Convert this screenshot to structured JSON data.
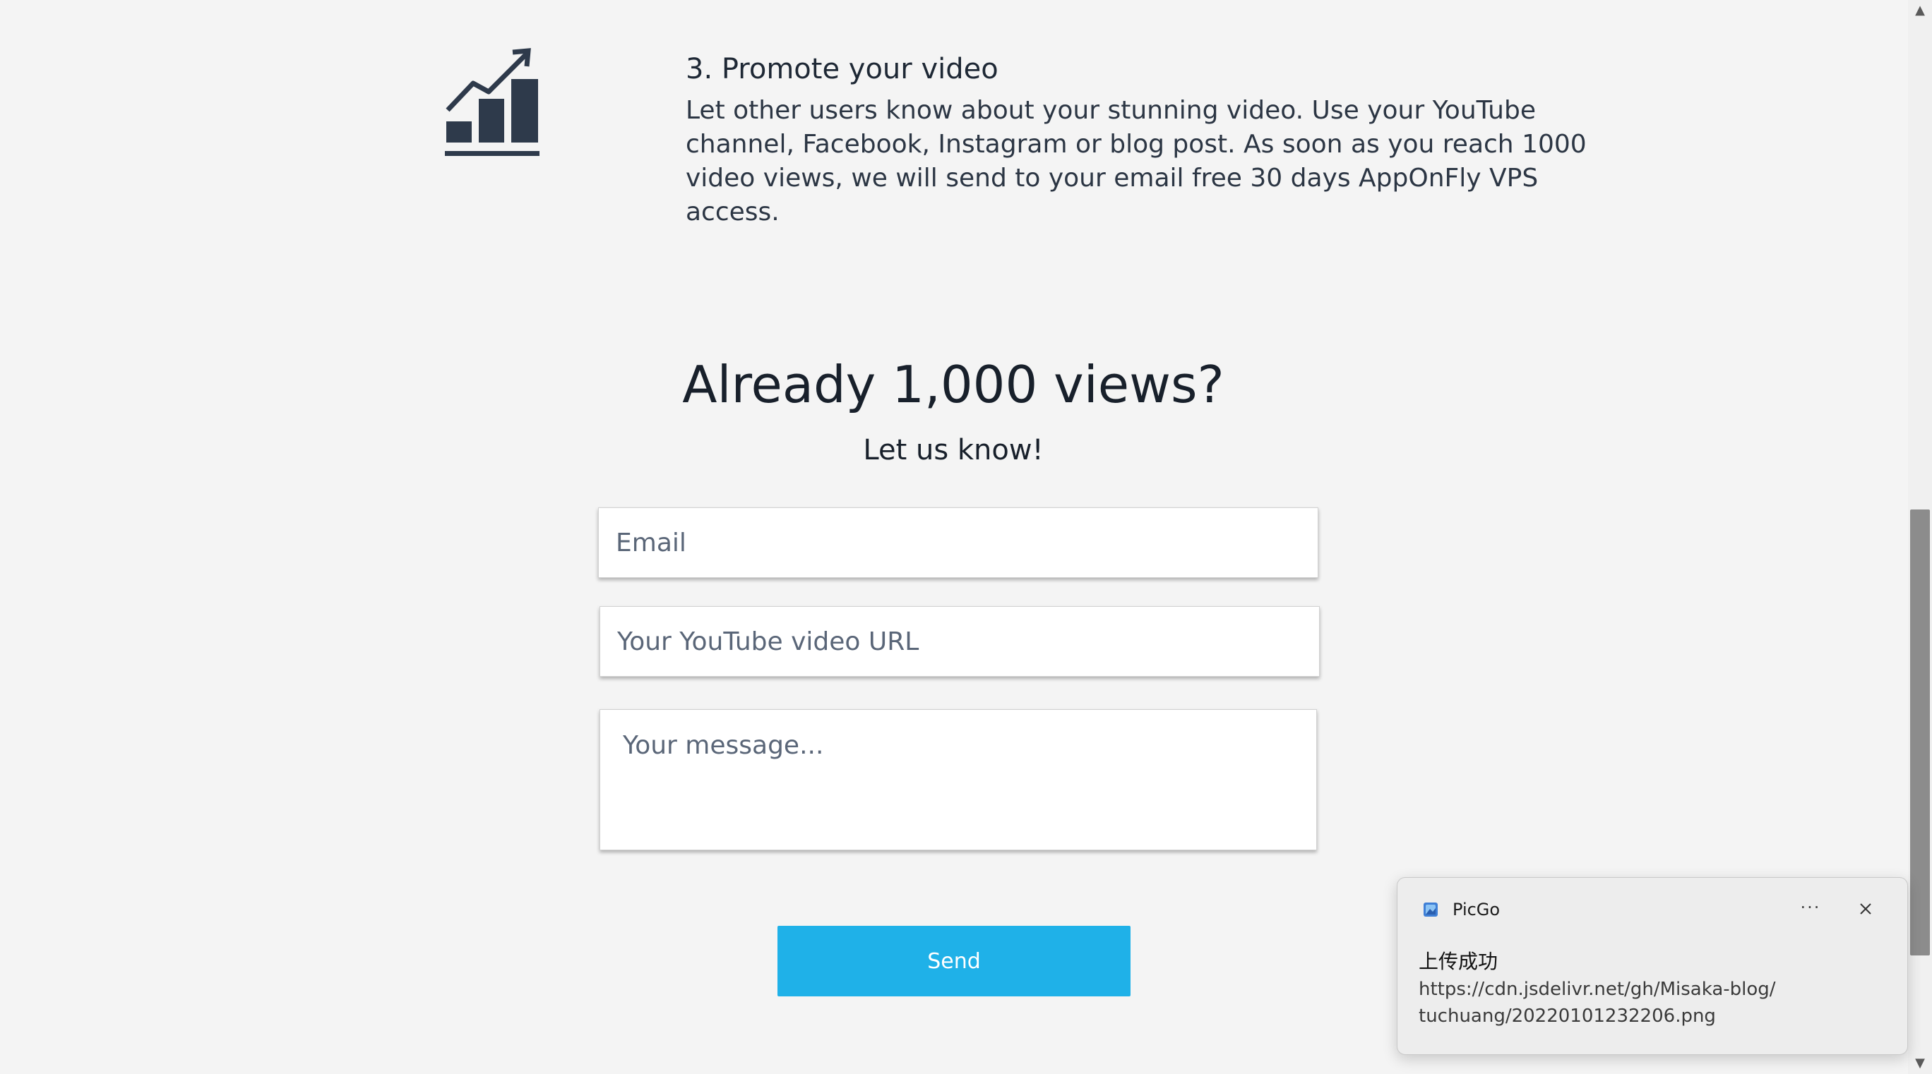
{
  "step": {
    "icon": "growth-chart-icon",
    "title": "3. Promote your video",
    "description": "Let other users know about your stunning video. Use your YouTube channel, Facebook, Instagram or blog post. As soon as you reach 1000 video views, we will send to your email free 30 days AppOnFly VPS access."
  },
  "cta": {
    "heading": "Already 1,000 views?",
    "subheading": "Let us know!"
  },
  "form": {
    "email_placeholder": "Email",
    "url_placeholder": "Your YouTube video URL",
    "message_placeholder": "Your message...",
    "send_label": "Send"
  },
  "notification": {
    "app_icon": "picgo-app-icon",
    "app_name": "PicGo",
    "more_label": "···",
    "close_icon": "close-icon",
    "title": "上传成功",
    "url_line1": "https://cdn.jsdelivr.net/gh/Misaka-blog/",
    "url_line2": "tuchuang/20220101232206.png"
  },
  "scrollbar": {
    "up_icon": "scroll-up-arrow-icon",
    "down_icon": "scroll-down-arrow-icon"
  },
  "colors": {
    "background": "#f4f4f4",
    "accent": "#1fb1e8",
    "icon": "#2e3a4b"
  }
}
